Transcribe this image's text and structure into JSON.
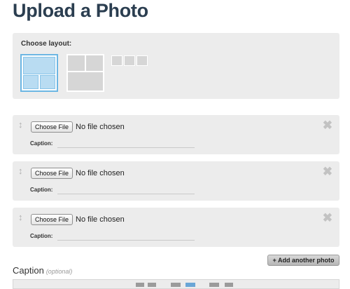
{
  "page": {
    "title": "Upload a Photo"
  },
  "layout": {
    "label": "Choose layout:",
    "options": [
      {
        "name": "large-top-two-bottom",
        "selected": true
      },
      {
        "name": "grid-four",
        "selected": false
      },
      {
        "name": "strip-three",
        "selected": false
      }
    ]
  },
  "photos": [
    {
      "file_button": "Choose File",
      "file_status": "No file chosen",
      "caption_label": "Caption:",
      "caption_value": ""
    },
    {
      "file_button": "Choose File",
      "file_status": "No file chosen",
      "caption_label": "Caption:",
      "caption_value": ""
    },
    {
      "file_button": "Choose File",
      "file_status": "No file chosen",
      "caption_label": "Caption:",
      "caption_value": ""
    }
  ],
  "icons": {
    "drag": "drag-handle-icon",
    "remove": "close-icon",
    "remove_glyph": "✖",
    "drag_glyph": "↕"
  },
  "add_photo_button": "+ Add another photo",
  "caption_section": {
    "heading": "Caption",
    "note": "(optional)"
  },
  "colors": {
    "title": "#2b3e50",
    "selected_layout": "#6cb6e3",
    "panel_bg": "#ececec"
  }
}
